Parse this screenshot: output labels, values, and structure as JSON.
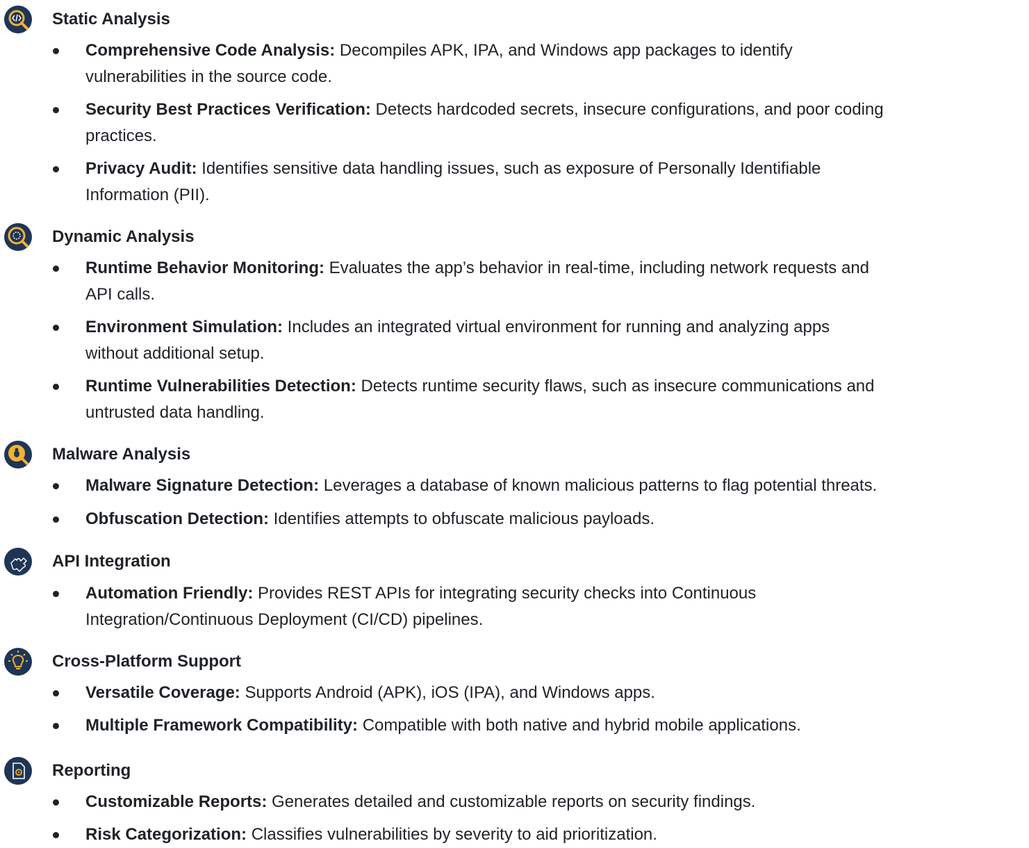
{
  "sections": [
    {
      "title": "Static Analysis",
      "icon": "code-magnifier-icon",
      "bullets": [
        {
          "term": "Comprehensive Code Analysis:",
          "desc": " Decompiles APK, IPA, and Windows app packages to identify",
          "desc2": "vulnerabilities in the source code."
        },
        {
          "term": "Security Best Practices Verification:",
          "desc": " Detects hardcoded secrets, insecure configurations, and poor coding",
          "desc2": "practices."
        },
        {
          "term": "Privacy Audit:",
          "desc": " Identifies sensitive data handling issues, such as exposure of Personally Identifiable",
          "desc2": "Information (PII)."
        }
      ]
    },
    {
      "title": "Dynamic Analysis",
      "icon": "gear-magnifier-icon",
      "bullets": [
        {
          "term": "Runtime Behavior Monitoring:",
          "desc": " Evaluates the app’s behavior in real-time, including network requests and",
          "desc2": "API calls."
        },
        {
          "term": "Environment Simulation:",
          "desc": " Includes an integrated virtual environment for running and analyzing apps",
          "desc2": "without additional setup."
        },
        {
          "term": "Runtime Vulnerabilities Detection:",
          "desc": " Detects runtime security flaws, such as insecure communications and",
          "desc2": "untrusted data handling."
        }
      ]
    },
    {
      "title": "Malware Analysis",
      "icon": "bug-magnifier-icon",
      "bullets": [
        {
          "term": "Malware Signature Detection:",
          "desc": " Leverages a database of known malicious patterns to flag potential threats.",
          "desc2": ""
        },
        {
          "term": "Obfuscation Detection:",
          "desc": " Identifies attempts to obfuscate malicious payloads.",
          "desc2": ""
        }
      ]
    },
    {
      "title": "API Integration",
      "icon": "puzzle-icon",
      "bullets": [
        {
          "term": "Automation Friendly:",
          "desc": " Provides REST APIs for integrating security checks into Continuous",
          "desc2": "Integration/Continuous Deployment (CI/CD) pipelines."
        }
      ]
    },
    {
      "title": "Cross-Platform Support",
      "icon": "lightbulb-icon",
      "bullets": [
        {
          "term": "Versatile Coverage:",
          "desc": " Supports Android (APK), iOS (IPA), and Windows apps.",
          "desc2": ""
        },
        {
          "term": "Multiple Framework Compatibility:",
          "desc": " Compatible with both native and hybrid mobile applications.",
          "desc2": ""
        }
      ]
    },
    {
      "title": "Reporting",
      "icon": "report-document-icon",
      "bullets": [
        {
          "term": "Customizable Reports:",
          "desc": " Generates detailed and customizable reports on security findings.",
          "desc2": ""
        },
        {
          "term": "Risk Categorization:",
          "desc": " Classifies vulnerabilities by severity to aid prioritization.",
          "desc2": ""
        }
      ]
    }
  ],
  "colors": {
    "icon_bg": "#1f3556",
    "icon_accent": "#f2b233",
    "text": "#1f2328"
  }
}
